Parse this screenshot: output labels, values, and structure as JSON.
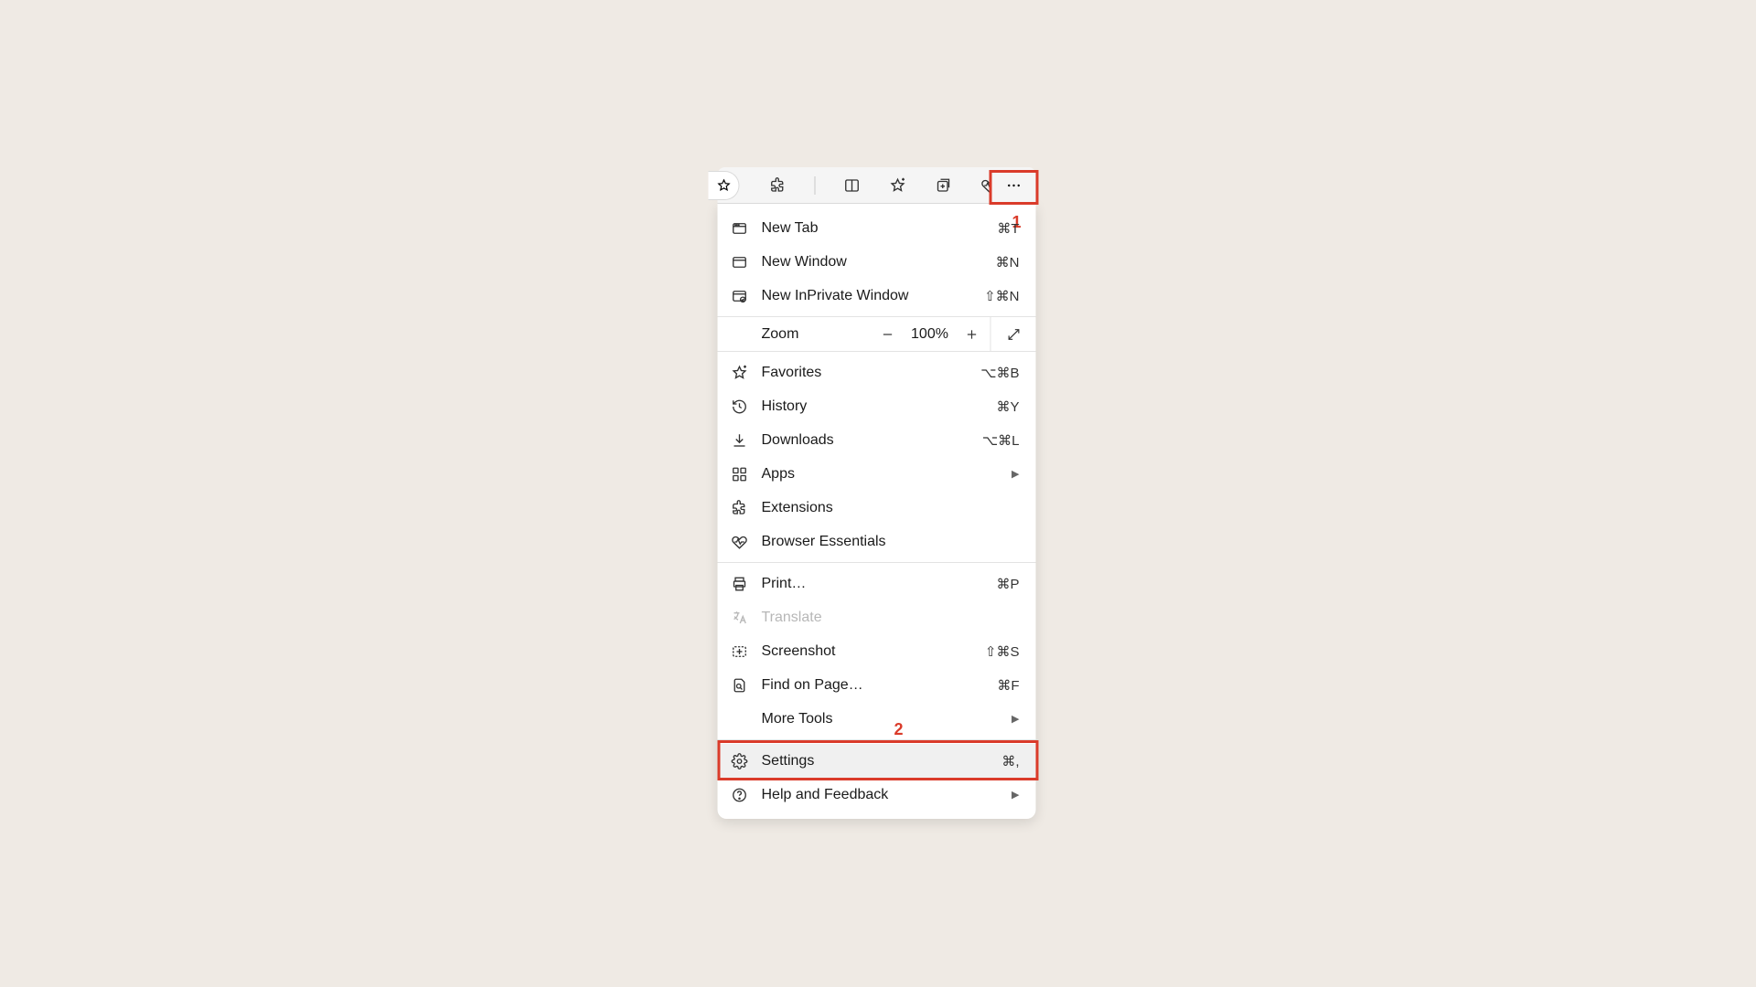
{
  "annotations": {
    "one": "1",
    "two": "2"
  },
  "toolbar": {
    "icons": [
      "star-icon",
      "extensions-icon",
      "split-screen-icon",
      "favorites-icon",
      "collections-icon",
      "essentials-icon"
    ]
  },
  "zoom": {
    "label": "Zoom",
    "value": "100%"
  },
  "menu": {
    "items": [
      {
        "icon": "new-tab-icon",
        "label": "New Tab",
        "shortcut": "⌘T"
      },
      {
        "icon": "new-window-icon",
        "label": "New Window",
        "shortcut": "⌘N"
      },
      {
        "icon": "inprivate-icon",
        "label": "New InPrivate Window",
        "shortcut": "⇧⌘N"
      }
    ],
    "items2": [
      {
        "icon": "favorites-icon",
        "label": "Favorites",
        "shortcut": "⌥⌘B"
      },
      {
        "icon": "history-icon",
        "label": "History",
        "shortcut": "⌘Y"
      },
      {
        "icon": "downloads-icon",
        "label": "Downloads",
        "shortcut": "⌥⌘L"
      },
      {
        "icon": "apps-icon",
        "label": "Apps",
        "submenu": true
      },
      {
        "icon": "extensions-icon",
        "label": "Extensions"
      },
      {
        "icon": "essentials-icon",
        "label": "Browser Essentials"
      }
    ],
    "items3": [
      {
        "icon": "print-icon",
        "label": "Print…",
        "shortcut": "⌘P"
      },
      {
        "icon": "translate-icon",
        "label": "Translate",
        "disabled": true
      },
      {
        "icon": "screenshot-icon",
        "label": "Screenshot",
        "shortcut": "⇧⌘S"
      },
      {
        "icon": "find-icon",
        "label": "Find on Page…",
        "shortcut": "⌘F"
      },
      {
        "icon": "",
        "label": "More Tools",
        "submenu": true
      }
    ],
    "items4": [
      {
        "icon": "settings-icon",
        "label": "Settings",
        "shortcut": "⌘,",
        "highlight": true
      },
      {
        "icon": "help-icon",
        "label": "Help and Feedback",
        "submenu": true
      }
    ]
  }
}
